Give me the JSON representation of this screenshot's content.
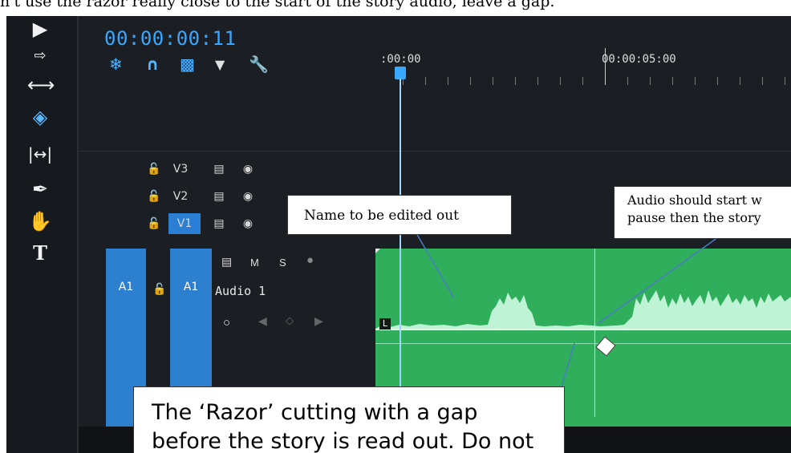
{
  "document": {
    "top_text": "n't use the razor really close to the start of the story audio, leave a gap."
  },
  "timeline": {
    "timecode": "00:00:00:11",
    "ruler": {
      "start": ":00:00",
      "mark": "00:00:05:00"
    },
    "toolbar_icons": [
      "snap-icon",
      "magnet-icon",
      "linked-selection-icon",
      "marker-icon",
      "wrench-icon"
    ],
    "tools": [
      "selection-tool-icon",
      "track-select-tool-icon",
      "ripple-edit-tool-icon",
      "razor-tool-icon",
      "slip-tool-icon",
      "pen-tool-icon",
      "hand-tool-icon",
      "type-tool-icon"
    ],
    "active_tool": "razor-tool-icon",
    "tracks": [
      {
        "label": "V3",
        "targeted": false
      },
      {
        "label": "V2",
        "targeted": false
      },
      {
        "label": "V1",
        "targeted": true
      }
    ],
    "audio_track": {
      "source": "A1",
      "target": "A1",
      "name": "Audio 1",
      "mute": "M",
      "solo": "S"
    },
    "clip_badge": "L",
    "colors": {
      "accent": "#3aa7ff",
      "clip": "#2fae5c",
      "waveform": "#bff3d6",
      "target": "#2d7fd0"
    }
  },
  "callouts": {
    "name_edit": "Name to be edited out",
    "audio_start": [
      "Audio should start w",
      "pause then the story"
    ],
    "razor": [
      "The ‘Razor’ cutting with a gap",
      "before the story is read out. Do not"
    ]
  }
}
